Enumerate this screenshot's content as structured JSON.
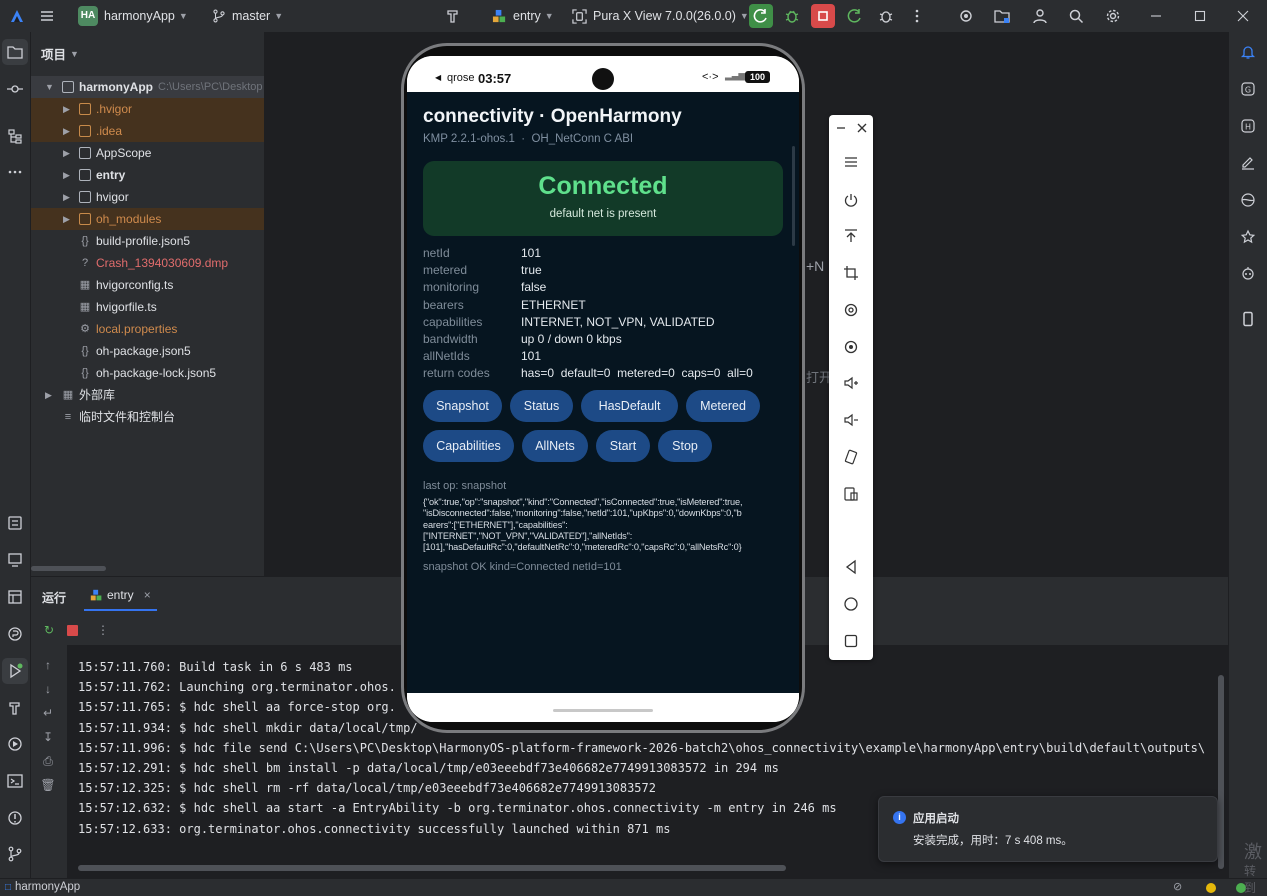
{
  "toolbar": {
    "project_badge": "HA",
    "project_name": "harmonyApp",
    "branch": "master",
    "run_config": "entry",
    "device": "Pura X View 7.0.0(26.0.0)"
  },
  "project_panel": {
    "title": "项目",
    "root_name": "harmonyApp",
    "root_path": "C:\\Users\\PC\\Desktop",
    "items": [
      {
        "label": ".hvigor",
        "kind": "folder",
        "style": "orange"
      },
      {
        "label": ".idea",
        "kind": "folder",
        "style": "orange"
      },
      {
        "label": "AppScope",
        "kind": "folder",
        "style": "normal"
      },
      {
        "label": "entry",
        "kind": "folder",
        "style": "bold"
      },
      {
        "label": "hvigor",
        "kind": "folder",
        "style": "normal"
      },
      {
        "label": "oh_modules",
        "kind": "folder",
        "style": "orange"
      },
      {
        "label": "build-profile.json5",
        "kind": "json",
        "style": "normal"
      },
      {
        "label": "Crash_1394030609.dmp",
        "kind": "unknown",
        "style": "red"
      },
      {
        "label": "hvigorconfig.ts",
        "kind": "ts",
        "style": "normal"
      },
      {
        "label": "hvigorfile.ts",
        "kind": "ts",
        "style": "normal"
      },
      {
        "label": "local.properties",
        "kind": "props",
        "style": "orange"
      },
      {
        "label": "oh-package.json5",
        "kind": "json",
        "style": "normal"
      },
      {
        "label": "oh-package-lock.json5",
        "kind": "json",
        "style": "normal"
      }
    ],
    "external_libs": "外部库",
    "scratches": "临时文件和控制台"
  },
  "editor_fragments": {
    "fragment_1": "+N",
    "fragment_2": "打开"
  },
  "run_panel": {
    "tab_run": "运行",
    "tab_entry": "entry",
    "close_glyph": "×",
    "console_lines": [
      "15:57:11.760: Build task in 6 s 483 ms",
      "15:57:11.762: Launching org.terminator.ohos.",
      "15:57:11.765: $ hdc shell aa force-stop org.",
      "15:57:11.934: $ hdc shell mkdir data/local/tmp/",
      "15:57:11.996: $ hdc file send C:\\Users\\PC\\Desktop\\HarmonyOS-platform-framework-2026-batch2\\ohos_connectivity\\example\\harmonyApp\\entry\\build\\default\\outputs\\",
      "15:57:12.291: $ hdc shell bm install -p data/local/tmp/e03eeebdf73e406682e7749913083572 in 294 ms",
      "15:57:12.325: $ hdc shell rm -rf data/local/tmp/e03eeebdf73e406682e7749913083572",
      "15:57:12.632: $ hdc shell aa start -a EntryAbility -b org.terminator.ohos.connectivity -m entry in 246 ms",
      "15:57:12.633: org.terminator.ohos.connectivity successfully launched within 871 ms"
    ]
  },
  "phone": {
    "status": {
      "carrier": "qrose",
      "time": "03:57",
      "battery": "100"
    },
    "app": {
      "title": "connectivity · OpenHarmony",
      "subtitle": "KMP 2.2.1-ohos.1  ·  OH_NetConn C ABI",
      "state_title": "Connected",
      "state_sub": "default net is present",
      "rows": [
        {
          "key": "netId",
          "value": "101"
        },
        {
          "key": "metered",
          "value": "true"
        },
        {
          "key": "monitoring",
          "value": "false"
        },
        {
          "key": "bearers",
          "value": "ETHERNET"
        },
        {
          "key": "capabilities",
          "value": "INTERNET, NOT_VPN, VALIDATED"
        },
        {
          "key": "bandwidth",
          "value": "up 0 / down 0 kbps"
        },
        {
          "key": "allNetIds",
          "value": "101"
        },
        {
          "key": "return codes",
          "value": "has=0  default=0  metered=0  caps=0  all=0"
        }
      ],
      "buttons_row1": [
        "Snapshot",
        "Status",
        "HasDefault",
        "Metered"
      ],
      "buttons_row2": [
        "Capabilities",
        "AllNets",
        "Start",
        "Stop"
      ],
      "last_op": "last op: snapshot",
      "json_lines": [
        "{\"ok\":true,\"op\":\"snapshot\",\"kind\":\"Connected\",\"isConnected\":true,\"isMetered\":true,",
        "\"isDisconnected\":false,\"monitoring\":false,\"netId\":101,\"upKbps\":0,\"downKbps\":0,\"b",
        "earers\":[\"ETHERNET\"],\"capabilities\":",
        "[\"INTERNET\",\"NOT_VPN\",\"VALIDATED\"],\"allNetIds\":",
        "[101],\"hasDefaultRc\":0,\"defaultNetRc\":0,\"meteredRc\":0,\"capsRc\":0,\"allNetsRc\":0}"
      ],
      "result": "snapshot OK kind=Connected netId=101"
    }
  },
  "notification": {
    "title": "应用启动",
    "body": "安装完成，用时：7 s 408 ms。"
  },
  "statusbar": {
    "project": "harmonyApp"
  },
  "watermark": {
    "line1": "激",
    "line2": "转到"
  },
  "colors": {
    "accent_green": "#3f8f47",
    "stop_red": "#d84a4a",
    "phone_bg": "#061520",
    "connected_card": "#123a28",
    "connected_text": "#5fe08c",
    "pill_button": "#1d4a86"
  }
}
